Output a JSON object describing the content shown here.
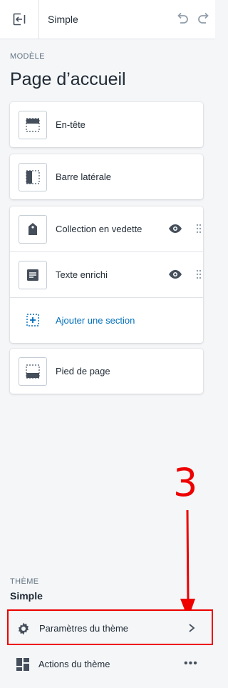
{
  "topbar": {
    "theme_name": "Simple"
  },
  "template": {
    "section_label": "MODÈLE",
    "page_title": "Page d’accueil"
  },
  "sections": {
    "header": "En-tête",
    "sidebar": "Barre latérale",
    "featured_collection": "Collection en vedette",
    "rich_text": "Texte enrichi",
    "add_section": "Ajouter une section",
    "footer": "Pied de page"
  },
  "theme": {
    "section_label": "THÈME",
    "name": "Simple",
    "settings_label": "Paramètres du thème",
    "actions_label": "Actions du thème",
    "actions_more": "•••"
  },
  "annotation": {
    "step": "3",
    "color": "#ee0000"
  },
  "icons": {
    "exit": "exit-icon",
    "undo": "undo-icon",
    "redo": "redo-icon",
    "header": "header-layout-icon",
    "sidebar": "sidebar-layout-icon",
    "collection": "tag-icon",
    "text": "text-block-icon",
    "add": "add-section-icon",
    "footer": "footer-layout-icon",
    "visibility": "eye-icon",
    "drag": "drag-handle-icon",
    "settings": "gear-icon",
    "chevron": "chevron-right-icon",
    "actions": "theme-actions-icon"
  }
}
